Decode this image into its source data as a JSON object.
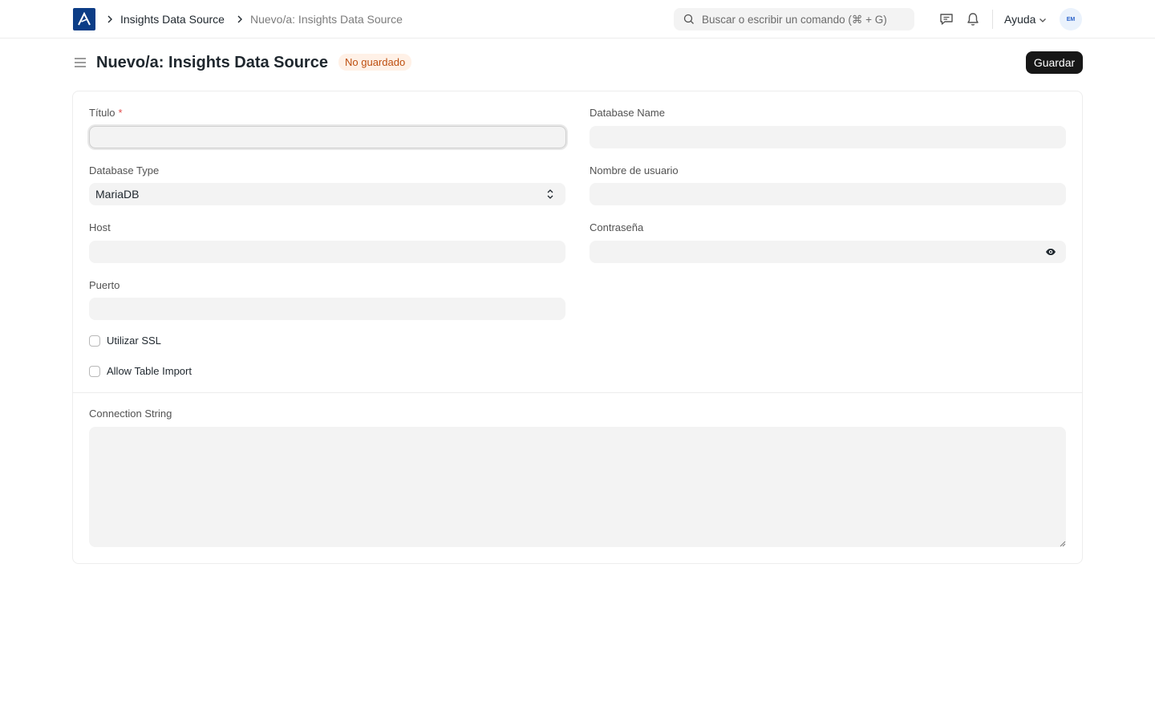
{
  "navbar": {
    "breadcrumbs": [
      "Insights Data Source",
      "Nuevo/a: Insights Data Source"
    ],
    "search_placeholder": "Buscar o escribir un comando (⌘ + G)",
    "help_label": "Ayuda",
    "avatar_initials": "EM",
    "logo_letter": "A"
  },
  "header": {
    "title": "Nuevo/a: Insights Data Source",
    "status_badge": "No guardado",
    "save_label": "Guardar"
  },
  "form": {
    "titulo_label": "Título",
    "titulo_value": "",
    "database_type_label": "Database Type",
    "database_type_value": "MariaDB",
    "host_label": "Host",
    "host_value": "",
    "puerto_label": "Puerto",
    "puerto_value": "",
    "database_name_label": "Database Name",
    "database_name_value": "",
    "username_label": "Nombre de usuario",
    "username_value": "",
    "password_label": "Contraseña",
    "password_value": "",
    "use_ssl_label": "Utilizar SSL",
    "use_ssl_checked": false,
    "allow_table_import_label": "Allow Table Import",
    "allow_table_import_checked": false,
    "connection_string_label": "Connection String",
    "connection_string_value": ""
  },
  "colors": {
    "logo_bg": "#0c3d86",
    "primary_button": "#171717",
    "badge_bg": "#fff1e7",
    "badge_text": "#bd4e0e",
    "field_bg": "#f3f3f3",
    "required_mark": "#e24c4c"
  }
}
